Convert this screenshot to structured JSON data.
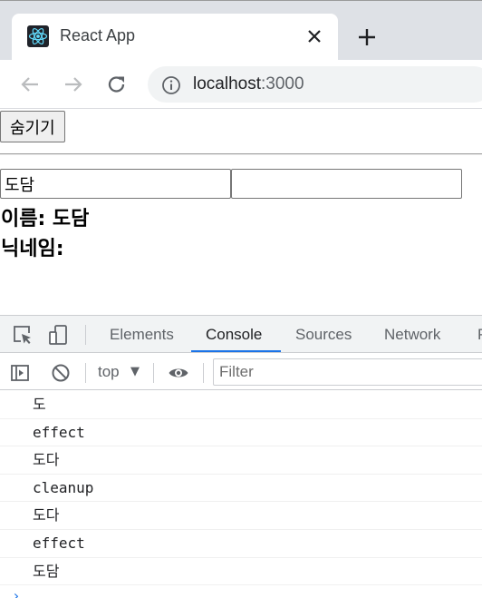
{
  "browser": {
    "tab_title": "React App",
    "url_host": "localhost",
    "url_port": ":3000",
    "favicon": "react-logo-icon"
  },
  "page": {
    "hide_button_label": "숨기기",
    "name_input_value": "도담",
    "nickname_input_value": "",
    "name_line": "이름: 도담",
    "nickname_line": "닉네임:"
  },
  "devtools": {
    "tabs": [
      "Elements",
      "Console",
      "Sources",
      "Network",
      "P"
    ],
    "active_tab": "Console",
    "context": "top",
    "filter_placeholder": "Filter",
    "logs": [
      "도",
      "effect",
      "도다",
      "cleanup",
      "도다",
      "effect",
      "도담"
    ],
    "prompt": "›"
  },
  "colors": {
    "tabstrip": "#dee1e6",
    "accent": "#1a73e8",
    "react": "#61dafb"
  }
}
